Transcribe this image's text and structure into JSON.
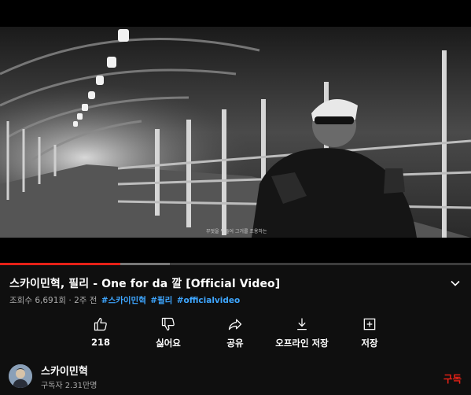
{
  "video": {
    "caption_text": "무엇을 뭐들어 그거를 조용하는"
  },
  "progress": {
    "played_fraction": 0.255,
    "buffered_fraction": 0.36,
    "played_color": "#e62117"
  },
  "title": "스카이민혁, 필리 - One for da 깔 [Official Video]",
  "meta": {
    "views": "조회수 6,691회",
    "sep": "·",
    "age": "2주 전",
    "hashtags": [
      "#스카이민혁",
      "#필리",
      "#officialvideo"
    ],
    "hashtag_color": "#3ea6ff"
  },
  "actions": [
    {
      "id": "like",
      "label": "218",
      "icon": "thumbs-up-icon"
    },
    {
      "id": "dislike",
      "label": "싫어요",
      "icon": "thumbs-down-icon"
    },
    {
      "id": "share",
      "label": "공유",
      "icon": "share-icon"
    },
    {
      "id": "download",
      "label": "오프라인 저장",
      "icon": "download-icon"
    },
    {
      "id": "save",
      "label": "저장",
      "icon": "playlist-add-icon"
    }
  ],
  "channel": {
    "name": "스카이민혁",
    "subscribers": "구독자 2.31만명",
    "subscribe_label": "구독"
  }
}
